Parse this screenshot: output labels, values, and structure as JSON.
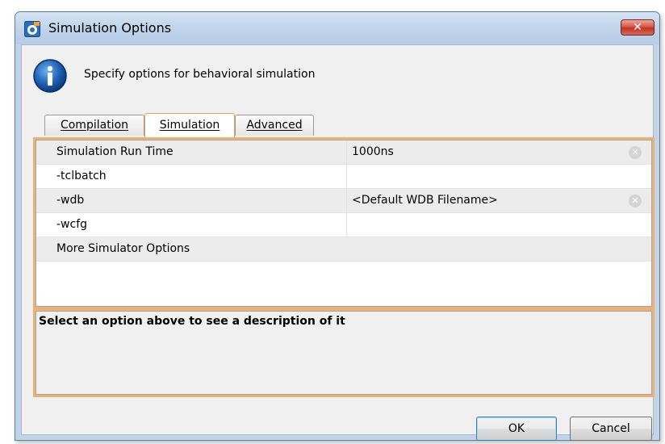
{
  "window": {
    "title": "Simulation Options",
    "close_glyph": "✕"
  },
  "header": {
    "text": "Specify options for behavioral simulation",
    "icon": "info-icon"
  },
  "tabs": [
    {
      "label": "Compilation",
      "active": false
    },
    {
      "label": "Simulation",
      "active": true
    },
    {
      "label": "Advanced",
      "active": false
    }
  ],
  "options": [
    {
      "name": "Simulation Run Time",
      "value": "1000ns",
      "clearable": true
    },
    {
      "name": "-tclbatch",
      "value": "",
      "clearable": false
    },
    {
      "name": "-wdb",
      "value": "<Default WDB Filename>",
      "clearable": true
    },
    {
      "name": "-wcfg",
      "value": "",
      "clearable": false
    },
    {
      "name": "More Simulator Options",
      "value": "",
      "clearable": false
    }
  ],
  "description": {
    "text": "Select an option above to see a description of it"
  },
  "buttons": {
    "ok": "OK",
    "cancel": "Cancel"
  },
  "colors": {
    "accent_border": "#efb172",
    "titlebar": "#c0d4ea",
    "close": "#c2352a"
  }
}
